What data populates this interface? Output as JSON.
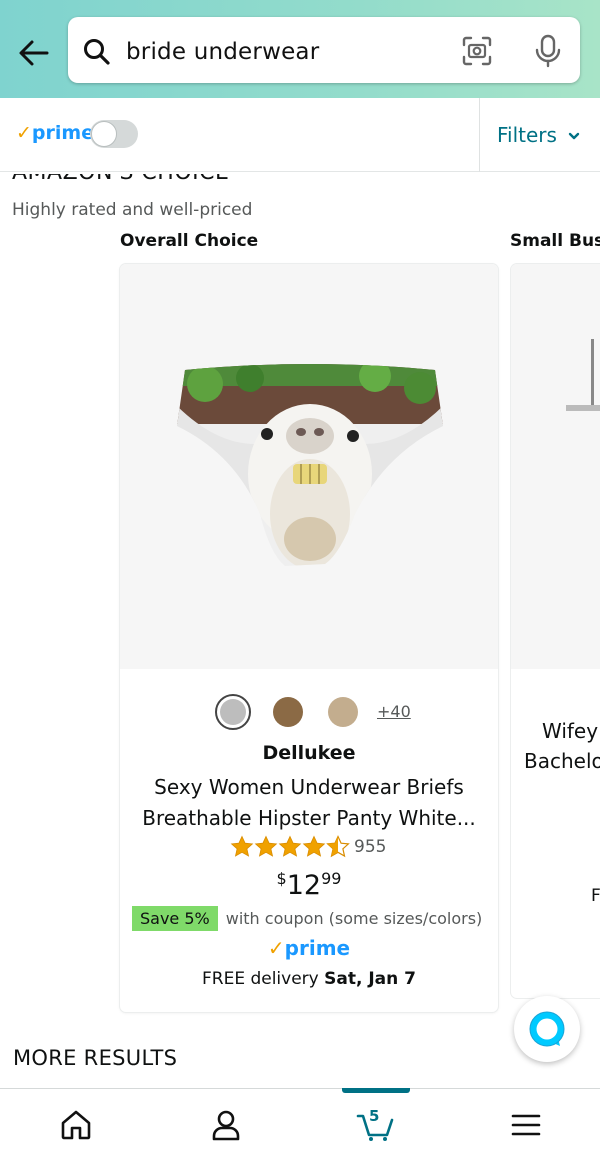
{
  "search": {
    "query": "bride underwear"
  },
  "subbar": {
    "prime_check": "✓",
    "prime_label": "prime",
    "filters_label": "Filters"
  },
  "section": {
    "title": "AMAZON'S CHOICE",
    "subtitle": "Highly rated and well-priced",
    "card_labels": [
      "Overall Choice",
      "Small Busi"
    ]
  },
  "product": {
    "more_colors": "+40",
    "brand": "Dellukee",
    "title_line1": "Sexy Women Underwear Briefs",
    "title_line2": "Breathable Hipster Panty White...",
    "rating": 4.5,
    "rating_count": "955",
    "price_symbol": "$",
    "price_whole": "12",
    "price_fraction": "99",
    "coupon_badge": "Save 5%",
    "coupon_text": "with coupon (some sizes/colors)",
    "prime_check": "✓",
    "prime_label": "prime",
    "delivery_prefix": "FREE delivery",
    "delivery_date": "Sat, Jan 7",
    "swatch_colors": [
      "#bdbdbd",
      "#8b6a45",
      "#c3ad8e"
    ]
  },
  "product2": {
    "title_line1": "Wifey",
    "title_line2": "Bachelo",
    "text_fragment": "F"
  },
  "more_results": "MORE RESULTS",
  "cart": {
    "count": "5"
  },
  "colors": {
    "header_gradient_start": "#7fd3cf",
    "header_gradient_end": "#a8e4c8",
    "link_teal": "#007185",
    "prime_blue": "#1a98ff",
    "star_orange": "#f0a100",
    "coupon_green": "#7fda69"
  }
}
